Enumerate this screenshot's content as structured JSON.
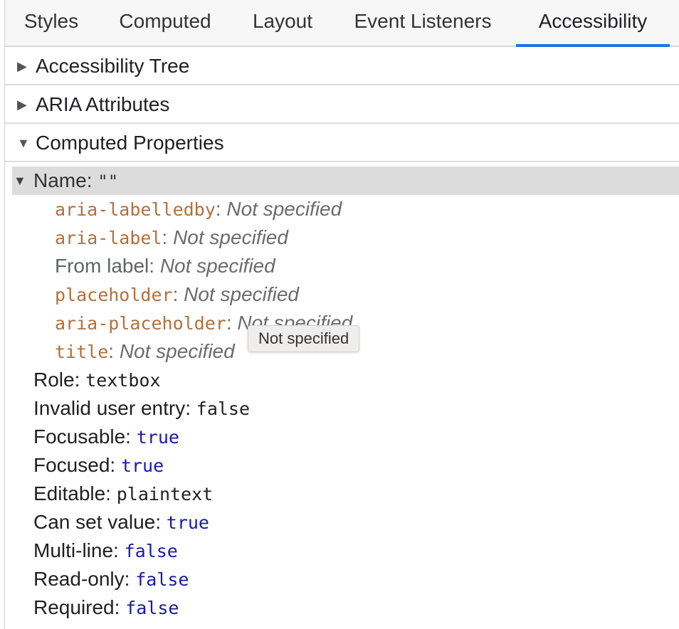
{
  "tabs": [
    {
      "label": "Styles",
      "active": false
    },
    {
      "label": "Computed",
      "active": false
    },
    {
      "label": "Layout",
      "active": false
    },
    {
      "label": "Event Listeners",
      "active": false
    },
    {
      "label": "Accessibility",
      "active": true
    }
  ],
  "sections": {
    "accessibility_tree": "Accessibility Tree",
    "aria_attributes": "ARIA Attributes",
    "computed_properties": "Computed Properties"
  },
  "name": {
    "label": "Name:",
    "value": "\"\""
  },
  "name_sources": [
    {
      "attr": "aria-labelledby",
      "is_attr": true,
      "value": "Not specified"
    },
    {
      "attr": "aria-label",
      "is_attr": true,
      "value": "Not specified"
    },
    {
      "attr": "From label",
      "is_attr": false,
      "value": "Not specified"
    },
    {
      "attr": "placeholder",
      "is_attr": true,
      "value": "Not specified"
    },
    {
      "attr": "aria-placeholder",
      "is_attr": true,
      "value": "Not specified"
    },
    {
      "attr": "title",
      "is_attr": true,
      "value": "Not specified"
    }
  ],
  "properties": [
    {
      "label": "Role:",
      "value": "textbox",
      "kind": "dark"
    },
    {
      "label": "Invalid user entry:",
      "value": "false",
      "kind": "dark"
    },
    {
      "label": "Focusable:",
      "value": "true",
      "kind": "blue"
    },
    {
      "label": "Focused:",
      "value": "true",
      "kind": "blue"
    },
    {
      "label": "Editable:",
      "value": "plaintext",
      "kind": "dark"
    },
    {
      "label": "Can set value:",
      "value": "true",
      "kind": "blue"
    },
    {
      "label": "Multi-line:",
      "value": "false",
      "kind": "blue"
    },
    {
      "label": "Read-only:",
      "value": "false",
      "kind": "blue"
    },
    {
      "label": "Required:",
      "value": "false",
      "kind": "blue"
    }
  ],
  "tooltip": "Not specified",
  "colors": {
    "accent": "#1a73e8",
    "attr_name": "#b0703e",
    "value_blue": "#1a1aa6"
  }
}
